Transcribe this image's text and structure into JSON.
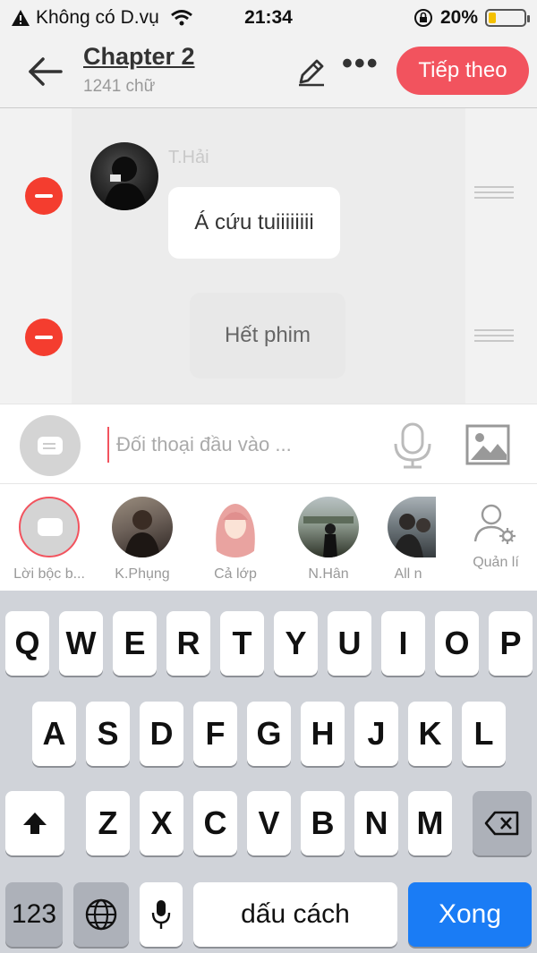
{
  "status_bar": {
    "carrier": "Không có D.vụ",
    "time": "21:34",
    "battery_pct": "20%",
    "battery_level": 0.2
  },
  "header": {
    "title": "Chapter 2",
    "word_count": "1241 chữ",
    "next_label": "Tiếp theo",
    "more": "•••"
  },
  "chat": {
    "messages": [
      {
        "speaker": "T.Hải",
        "text": "Á cứu tuiiiiiiii"
      },
      {
        "speaker": "",
        "text": "Hết phim"
      }
    ]
  },
  "composer": {
    "placeholder": "Đối thoại đầu vào ..."
  },
  "characters": {
    "items": [
      {
        "name": "Lời bộc b..."
      },
      {
        "name": "K.Phụng"
      },
      {
        "name": "Cả lớp"
      },
      {
        "name": "N.Hân"
      },
      {
        "name": "All n"
      }
    ],
    "manage_label": "Quản lí"
  },
  "keyboard": {
    "row1": [
      "Q",
      "W",
      "E",
      "R",
      "T",
      "Y",
      "U",
      "I",
      "O",
      "P"
    ],
    "row2": [
      "A",
      "S",
      "D",
      "F",
      "G",
      "H",
      "J",
      "K",
      "L"
    ],
    "row3": [
      "Z",
      "X",
      "C",
      "V",
      "B",
      "N",
      "M"
    ],
    "numbers_label": "123",
    "space_label": "dấu cách",
    "done_label": "Xong"
  },
  "colors": {
    "accent": "#f2535e",
    "delete": "#f43d2f",
    "done_key": "#1a7cf5"
  }
}
